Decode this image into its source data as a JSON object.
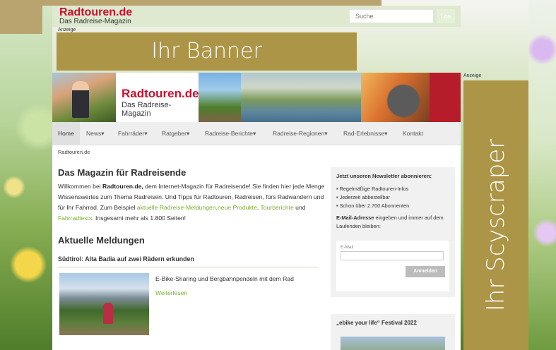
{
  "site": {
    "name": "Radtouren.de",
    "tagline": "Das Radreise-Magazin"
  },
  "search": {
    "placeholder": "Suche",
    "button": "Los"
  },
  "ads": {
    "label_top": "Anzeige",
    "label_right": "Anzeige",
    "banner_text": "Ihr Banner",
    "scyscraper_text": "Ihr Scyscraper"
  },
  "nav": {
    "items": [
      {
        "label": "Home"
      },
      {
        "label": "News",
        "caret": "▾"
      },
      {
        "label": "Fahrräder",
        "caret": "▾"
      },
      {
        "label": "Ratgeber",
        "caret": "▾"
      },
      {
        "label": "Radreise-Berichte",
        "caret": "▾"
      },
      {
        "label": "Radreise-Regionen",
        "caret": "▾"
      },
      {
        "label": "Rad-Erlebnisse",
        "caret": "▾"
      },
      {
        "label": "Kontakt"
      }
    ]
  },
  "breadcrumb": "Radtouren.de",
  "intro": {
    "title": "Das Magazin für Radreisende",
    "p_prefix": "Willkommen bei ",
    "p_bold": "Radtouren.de,",
    "p_middle": " dem Internet-Magazin für Radreisende! Sie finden hier jede Menge Wissenswertes zum Thema Radreisen. Und Tipps für Radtouren, Radreisen, fürs Radwandern und für Ihr Fahrrad. Zum Beispiel ",
    "link1": "aktuelle Radreise-Meldungen,",
    "link2": "neue Produkte",
    "sep": ", ",
    "link3": "Tourberichte",
    "and": " und ",
    "link4": "Fahrradtests.",
    "p_suffix": " Insgesamt mehr als 1.800 Seiten!"
  },
  "news": {
    "section_title": "Aktuelle Meldungen",
    "headline": "Südtirol: Alta Badia auf zwei Rädern erkunden",
    "teaser": "E-Bike-Sharing und Bergbahnpendeln mit dem Rad",
    "more": "Weiterlesen"
  },
  "newsletter": {
    "title": "Jetzt unseren Newsletter abonnieren:",
    "bullets": [
      "• Regelmäßige Radtouren-Infos",
      "• Jederzeit abbestellbar",
      "• Schon über 2.700 Abonnenten"
    ],
    "desc_bold": "E-Mail-Adresse",
    "desc_rest": " eingeben und immer auf dem Laufenden bleiben:",
    "field_label": "E-Mail",
    "button": "Anmelden"
  },
  "festival": {
    "title": "„ebike your life“ Festival 2022"
  },
  "colors": {
    "brand_red": "#c8102e",
    "link_green": "#7cae2d",
    "ad_gold": "#ac9547"
  }
}
